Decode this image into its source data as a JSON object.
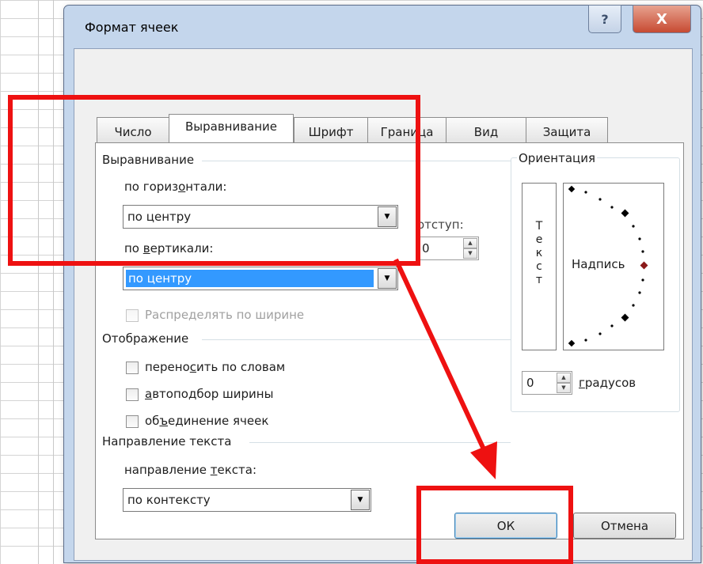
{
  "dialog": {
    "title": "Формат ячеек",
    "help_label": "?",
    "close_label": "X"
  },
  "tabs": [
    {
      "label": "Число"
    },
    {
      "label": "Выравнивание"
    },
    {
      "label": "Шрифт"
    },
    {
      "label": "Граница"
    },
    {
      "label": "Вид"
    },
    {
      "label": "Защита"
    }
  ],
  "alignment": {
    "group_title": "Выравнивание",
    "horizontal": {
      "label_pre": "по гориз",
      "label_ul": "о",
      "label_post": "нтали:",
      "value": "по центру"
    },
    "indent": {
      "label": "отступ:",
      "value": "0"
    },
    "vertical": {
      "label_pre": "по ",
      "label_ul": "в",
      "label_post": "ертикали:",
      "value": "по центру"
    },
    "distribute_label": "Распределять по ширине"
  },
  "display": {
    "group_title": "Отображение",
    "wrap": {
      "label_pre": "перено",
      "label_ul": "с",
      "label_post": "ить по словам"
    },
    "autofit": {
      "label_pre": "",
      "label_ul": "а",
      "label_post": "втоподбор ширины"
    },
    "merge": {
      "label_pre": "об",
      "label_ul": "ъ",
      "label_post": "единение ячеек"
    }
  },
  "direction": {
    "group_title": "Направление текста",
    "label_pre": "направление ",
    "label_ul": "т",
    "label_post": "екста:",
    "value": "по контексту"
  },
  "orientation": {
    "group_title": "Ориентация",
    "vertical_text": [
      "Т",
      "е",
      "к",
      "с",
      "т"
    ],
    "label": "Надпись",
    "degrees_value": "0",
    "degrees_label_ul": "г",
    "degrees_label_post": "радусов"
  },
  "buttons": {
    "ok": "ОК",
    "cancel": "Отмена"
  },
  "colors": {
    "annotation_red": "#ee1111",
    "selection_blue": "#3399ff",
    "angle_marker": "#8b1a1a"
  }
}
